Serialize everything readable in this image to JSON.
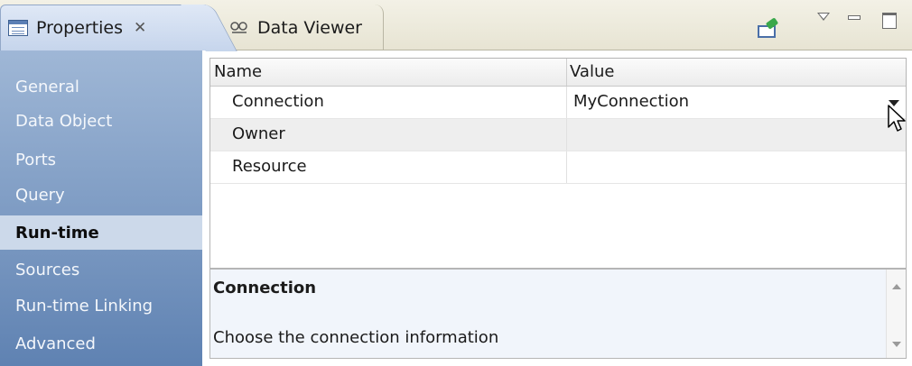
{
  "tabs": [
    {
      "label": "Properties",
      "icon": "properties-icon",
      "active": true,
      "close": "✕"
    },
    {
      "label": "Data Viewer",
      "icon": "data-viewer-icon",
      "active": false
    }
  ],
  "toolbar": {
    "icons": [
      "pin-editor-icon",
      "view-menu-icon",
      "minimize-icon",
      "maximize-icon"
    ]
  },
  "nav": {
    "items": [
      {
        "label": "General"
      },
      {
        "label": "Data Object"
      },
      {
        "label": "Ports"
      },
      {
        "label": "Query"
      },
      {
        "label": "Run-time",
        "active": true
      },
      {
        "label": "Sources"
      },
      {
        "label": "Run-time Linking"
      },
      {
        "label": "Advanced"
      }
    ]
  },
  "grid": {
    "columns": [
      "Name",
      "Value"
    ],
    "rows": [
      {
        "name": "Connection",
        "value": "MyConnection"
      },
      {
        "name": "Owner",
        "value": ""
      },
      {
        "name": "Resource",
        "value": ""
      }
    ]
  },
  "description": {
    "title": "Connection",
    "text": "Choose the connection information"
  },
  "colors": {
    "nav_top": "#9fb7d6",
    "nav_bottom": "#5f82b2",
    "active_nav": "#ccd9ea"
  }
}
